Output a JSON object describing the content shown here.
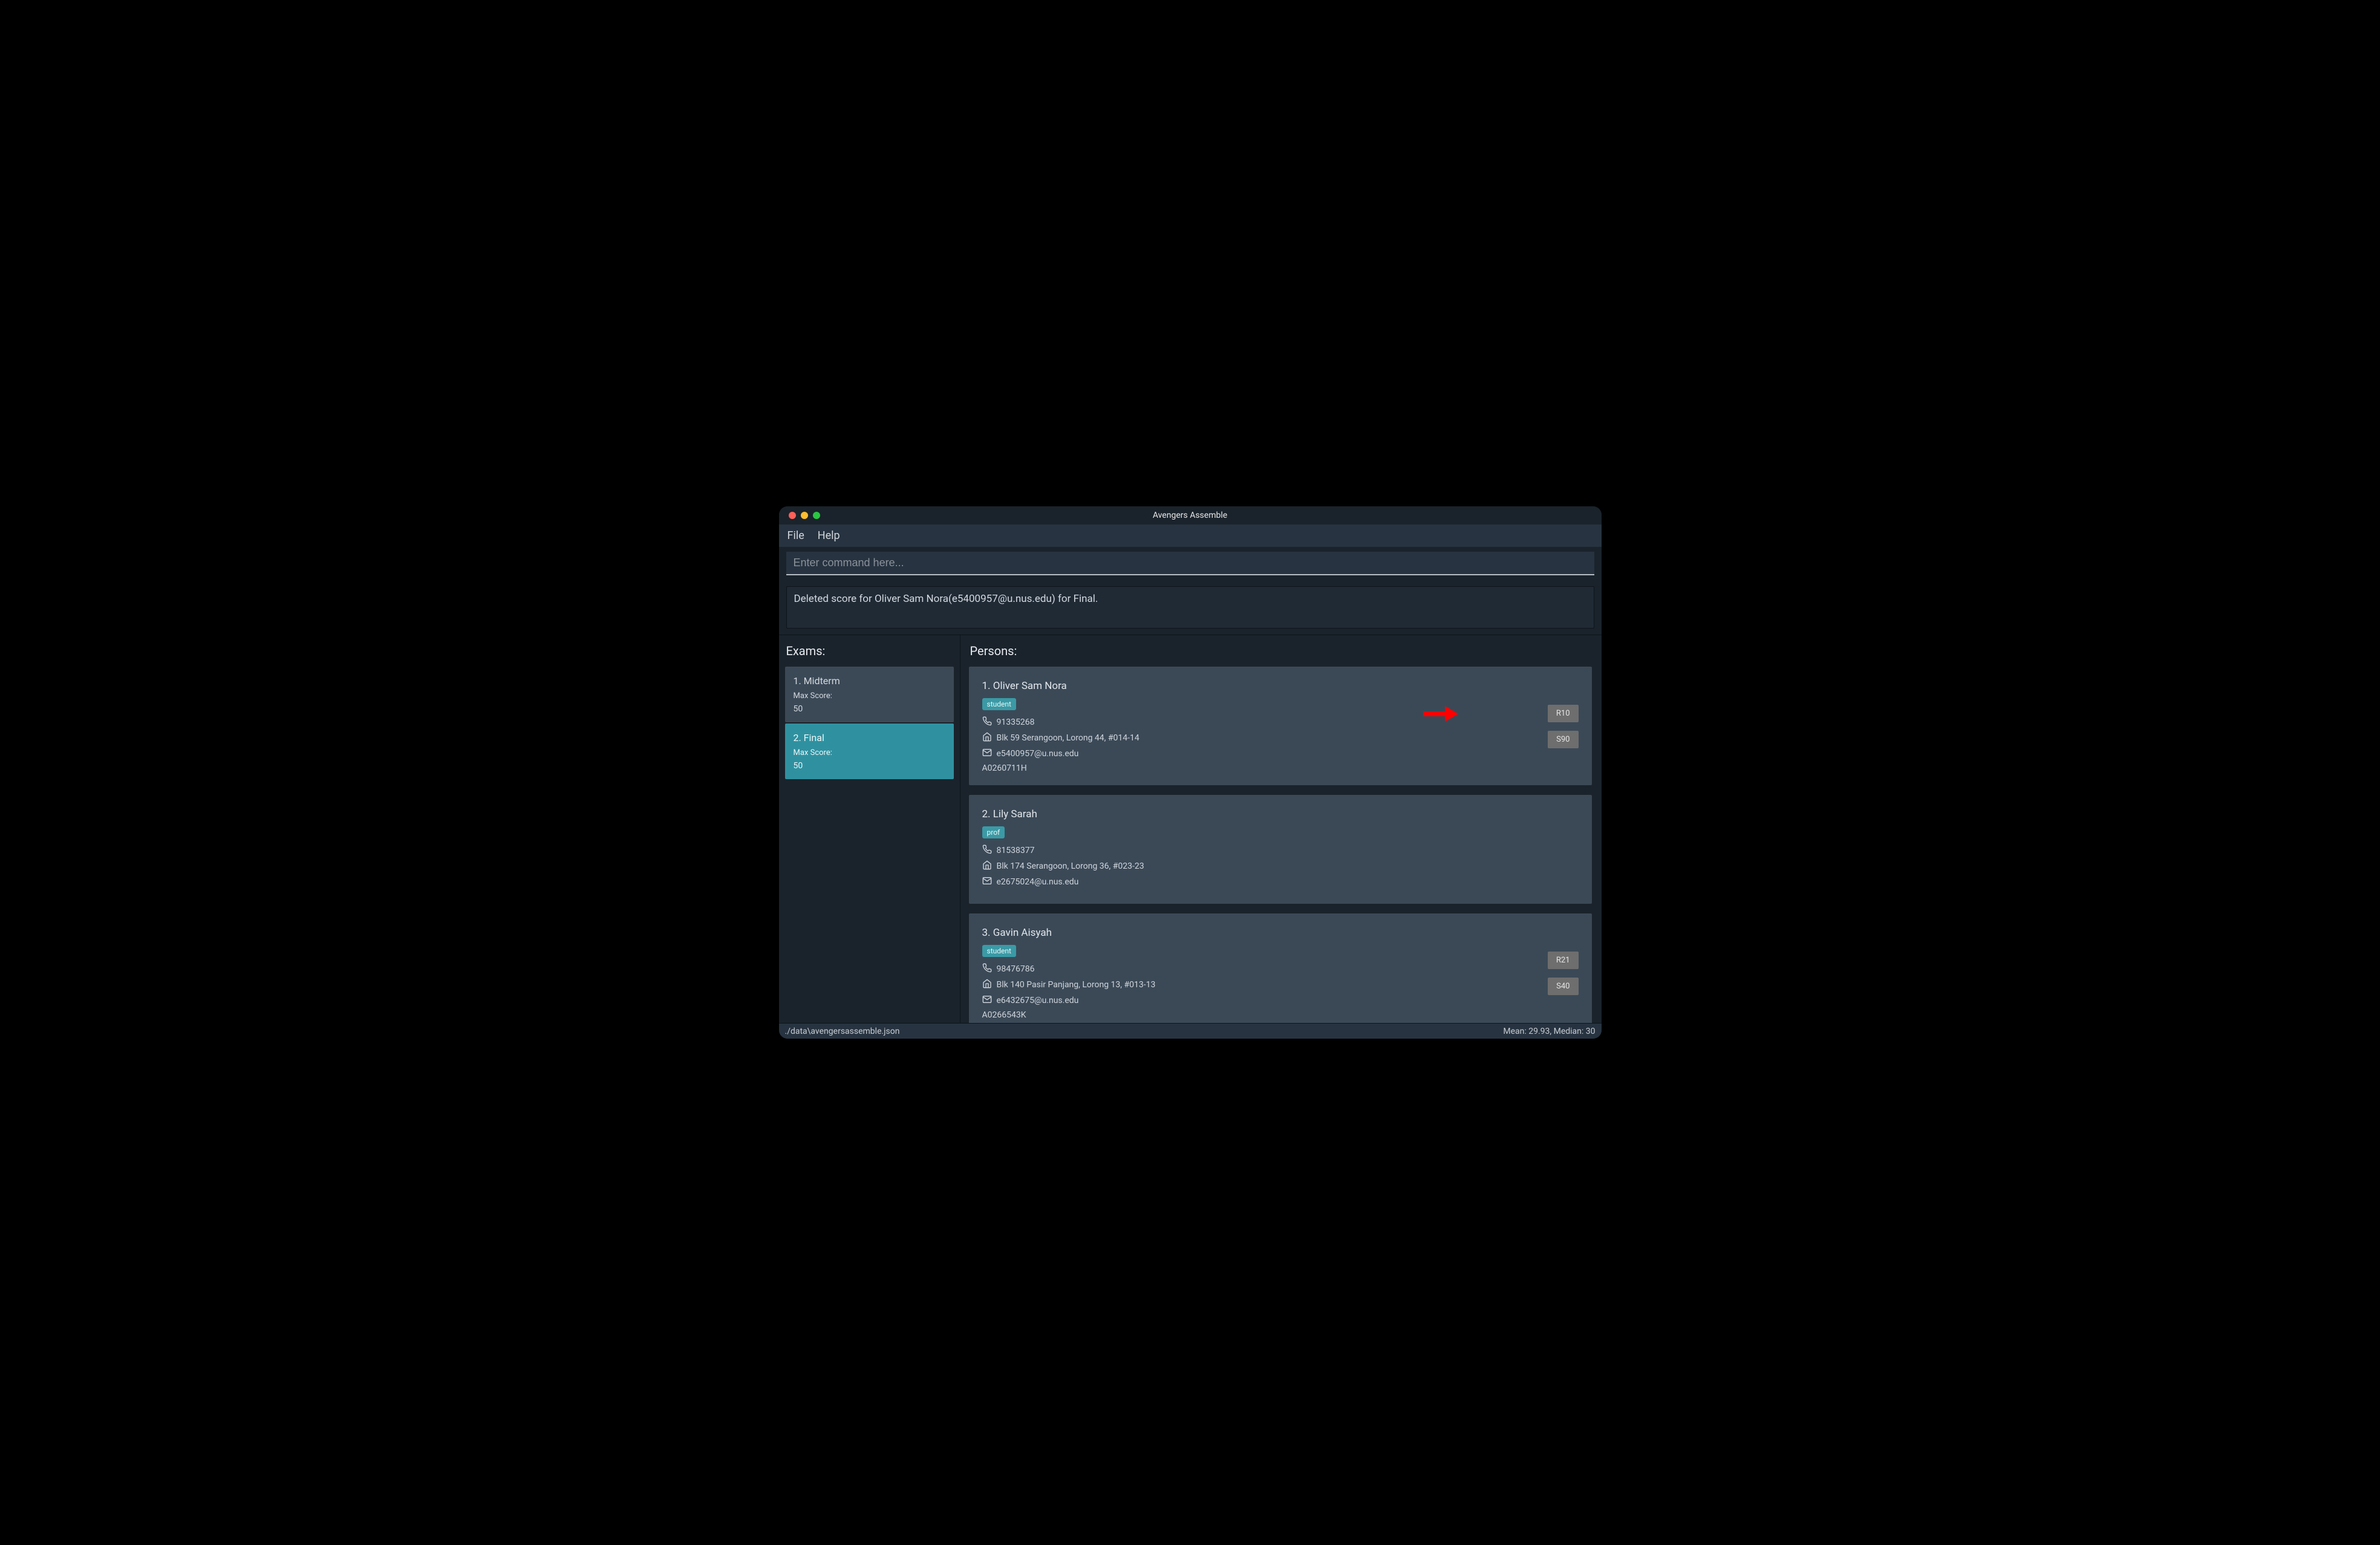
{
  "window": {
    "title": "Avengers Assemble"
  },
  "menubar": {
    "file": "File",
    "help": "Help"
  },
  "command": {
    "placeholder": "Enter command here..."
  },
  "result": {
    "message": "Deleted score for Oliver Sam Nora(e5400957@u.nus.edu) for Final."
  },
  "panels": {
    "exams_title": "Exams:",
    "persons_title": "Persons:"
  },
  "exams": [
    {
      "index": "1.",
      "name": "Midterm",
      "max_label": "Max Score:",
      "max_value": "50",
      "selected": false
    },
    {
      "index": "2.",
      "name": "Final",
      "max_label": "Max Score:",
      "max_value": "50",
      "selected": true
    }
  ],
  "persons": [
    {
      "index": "1.",
      "name": "Oliver Sam Nora",
      "tags": [
        "student"
      ],
      "phone": "91335268",
      "address": "Blk 59 Serangoon, Lorong 44, #014-14",
      "email": "e5400957@u.nus.edu",
      "matric": "A0260711H",
      "badges": [
        "R10",
        "S90"
      ]
    },
    {
      "index": "2.",
      "name": "Lily Sarah",
      "tags": [
        "prof"
      ],
      "phone": "81538377",
      "address": "Blk 174 Serangoon, Lorong 36, #023-23",
      "email": "e2675024@u.nus.edu",
      "matric": "",
      "badges": []
    },
    {
      "index": "3.",
      "name": "Gavin Aisyah",
      "tags": [
        "student"
      ],
      "phone": "98476786",
      "address": "Blk 140 Pasir Panjang, Lorong 13, #013-13",
      "email": "e6432675@u.nus.edu",
      "matric": "A0266543K",
      "badges": [
        "R21",
        "S40"
      ]
    }
  ],
  "statusbar": {
    "path": "./data\\avengersassemble.json",
    "stats": "Mean: 29.93, Median: 30"
  },
  "annotation": {
    "arrow_color": "#ff0000"
  }
}
